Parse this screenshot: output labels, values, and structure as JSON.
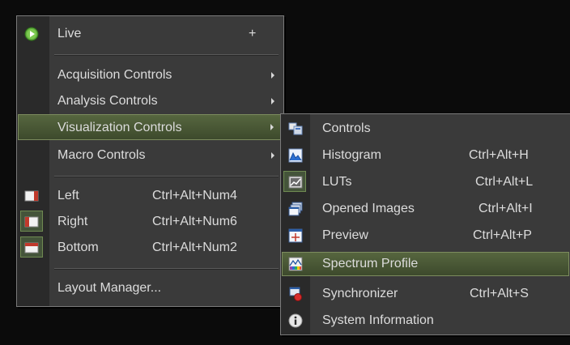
{
  "main_menu": {
    "live": {
      "label": "Live",
      "shortcut": "+"
    },
    "acquisition": {
      "label": "Acquisition Controls"
    },
    "analysis": {
      "label": "Analysis Controls"
    },
    "visualization": {
      "label": "Visualization Controls"
    },
    "macro": {
      "label": "Macro Controls"
    },
    "left": {
      "label": "Left",
      "shortcut": "Ctrl+Alt+Num4"
    },
    "right": {
      "label": "Right",
      "shortcut": "Ctrl+Alt+Num6"
    },
    "bottom": {
      "label": "Bottom",
      "shortcut": "Ctrl+Alt+Num2"
    },
    "layout": {
      "label": "Layout Manager..."
    }
  },
  "submenu": {
    "controls": {
      "label": "Controls",
      "shortcut": ""
    },
    "histogram": {
      "label": "Histogram",
      "shortcut": "Ctrl+Alt+H"
    },
    "luts": {
      "label": "LUTs",
      "shortcut": "Ctrl+Alt+L"
    },
    "opened_images": {
      "label": "Opened Images",
      "shortcut": "Ctrl+Alt+I"
    },
    "preview": {
      "label": "Preview",
      "shortcut": "Ctrl+Alt+P"
    },
    "spectrum": {
      "label": "Spectrum Profile",
      "shortcut": ""
    },
    "synchronizer": {
      "label": "Synchronizer",
      "shortcut": "Ctrl+Alt+S"
    },
    "system_info": {
      "label": "System Information",
      "shortcut": ""
    }
  },
  "colors": {
    "highlight": "#4b5a36",
    "menu_bg": "#3a3a3a",
    "text": "#dcdcdc"
  }
}
